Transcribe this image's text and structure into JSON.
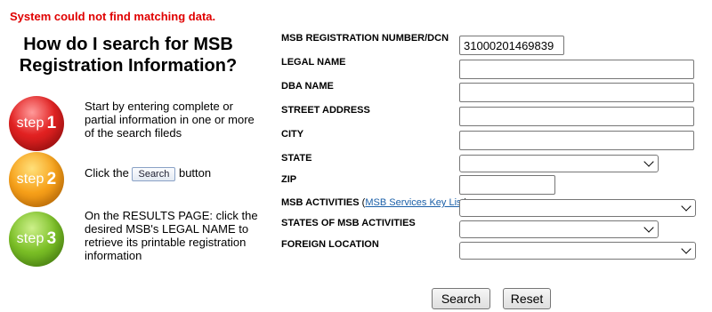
{
  "error_message": "System could not find matching data.",
  "howto": {
    "title": "How do I search for MSB Registration Information?",
    "steps": [
      {
        "word": "step",
        "number": "1",
        "color": "red",
        "text": "Start by entering complete or partial information in one or more of the search fileds"
      },
      {
        "word": "step",
        "number": "2",
        "color": "orange",
        "text_before": "Click the",
        "button_label": "Search",
        "text_after": "button"
      },
      {
        "word": "step",
        "number": "3",
        "color": "green",
        "text": "On the RESULTS PAGE: click the desired MSB's LEGAL NAME to retrieve its printable registration information"
      }
    ]
  },
  "form": {
    "registration_number": {
      "label": "MSB REGISTRATION NUMBER/DCN",
      "value": "31000201469839"
    },
    "legal_name": {
      "label": "LEGAL NAME",
      "value": ""
    },
    "dba_name": {
      "label": "DBA NAME",
      "value": ""
    },
    "street_address": {
      "label": "STREET ADDRESS",
      "value": ""
    },
    "city": {
      "label": "CITY",
      "value": ""
    },
    "state": {
      "label": "STATE",
      "selected": ""
    },
    "zip": {
      "label": "ZIP",
      "value": ""
    },
    "msb_activities": {
      "label": "MSB ACTIVITIES",
      "link_open": "(",
      "link_text": "MSB Services Key List",
      "link_close": ")",
      "selected": ""
    },
    "states_of_msb_activities": {
      "label": "STATES OF MSB ACTIVITIES",
      "selected": ""
    },
    "foreign_location": {
      "label": "FOREIGN LOCATION",
      "selected": ""
    }
  },
  "buttons": {
    "search": "Search",
    "reset": "Reset"
  },
  "colors": {
    "error": "#e00000",
    "link": "#1a5fa8",
    "step1": "#e22222",
    "step2": "#f7a11a",
    "step3": "#7bbf26"
  }
}
